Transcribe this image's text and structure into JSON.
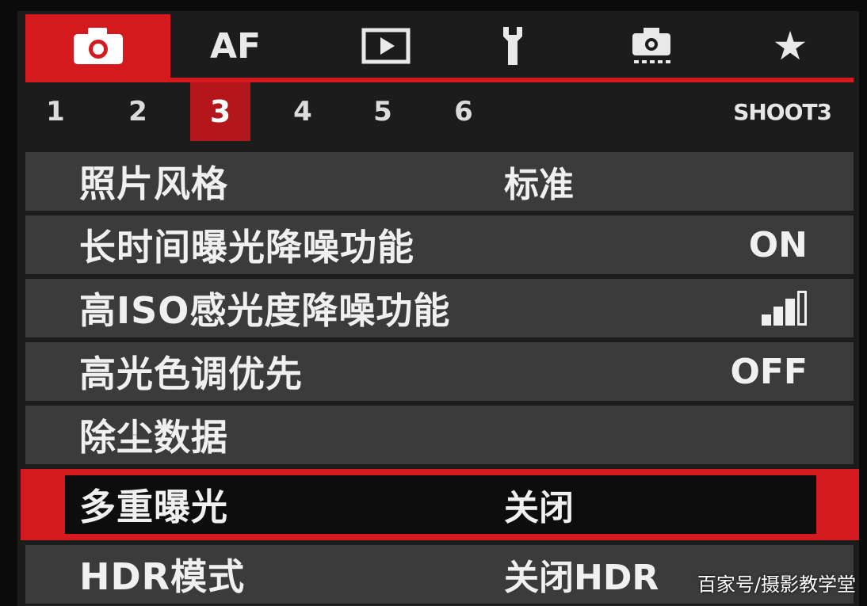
{
  "categories": [
    {
      "name": "shooting",
      "icon": "camera-icon",
      "label": ""
    },
    {
      "name": "af",
      "icon": "af-icon",
      "label": "AF"
    },
    {
      "name": "playback",
      "icon": "play-icon",
      "label": ""
    },
    {
      "name": "setup",
      "icon": "wrench-icon",
      "label": ""
    },
    {
      "name": "custom",
      "icon": "custom-camera-icon",
      "label": ""
    },
    {
      "name": "mymenu",
      "icon": "star-icon",
      "label": ""
    }
  ],
  "active_category": "shooting",
  "pages": [
    "1",
    "2",
    "3",
    "4",
    "5",
    "6"
  ],
  "active_page": "3",
  "page_code": "SHOOT3",
  "menu": [
    {
      "label": "照片风格",
      "value": "标准"
    },
    {
      "label": "长时间曝光降噪功能",
      "value": "ON"
    },
    {
      "label": "高ISO感光度降噪功能",
      "value": "",
      "value_icon": "nr-level-bars-icon",
      "level": 3,
      "level_max": 4
    },
    {
      "label": "高光色调优先",
      "value": "OFF"
    },
    {
      "label": "除尘数据",
      "value": ""
    },
    {
      "label": "多重曝光",
      "value": "关闭"
    },
    {
      "label": "HDR模式",
      "value": "关闭HDR"
    }
  ],
  "selected_index": 5,
  "colors": {
    "accent": "#d51a1f",
    "row_bg": "#3b3b3b",
    "screen_bg": "#1c1c1c"
  },
  "watermark": "百家号/摄影教学堂"
}
